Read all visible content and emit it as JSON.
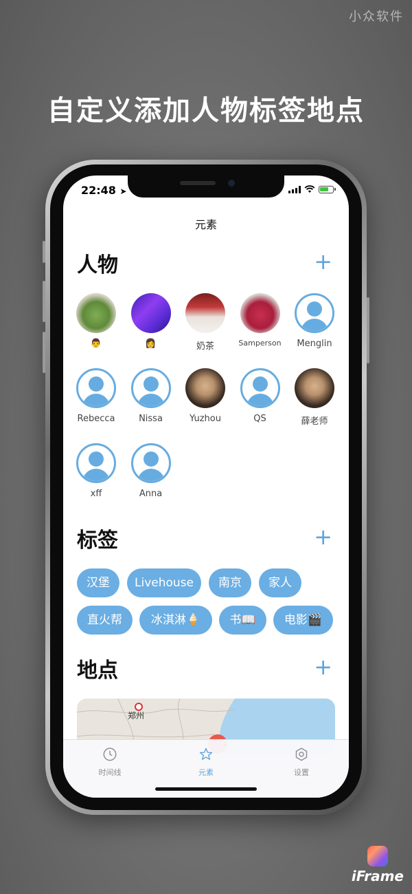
{
  "watermark": "小众软件",
  "headline": "自定义添加人物标签地点",
  "status": {
    "time": "22:48"
  },
  "nav_title": "元素",
  "sections": {
    "people": {
      "title": "人物"
    },
    "tags": {
      "title": "标签"
    },
    "places": {
      "title": "地点"
    }
  },
  "people": [
    {
      "name": "👨",
      "avatar": "photo-food"
    },
    {
      "name": "👩",
      "avatar": "photo-purple"
    },
    {
      "name": "奶茶",
      "avatar": "photo-milktea"
    },
    {
      "name": "Samperson",
      "avatar": "photo-bear"
    },
    {
      "name": "Menglin",
      "avatar": "default"
    },
    {
      "name": "Rebecca",
      "avatar": "default"
    },
    {
      "name": "Nissa",
      "avatar": "default"
    },
    {
      "name": "Yuzhou",
      "avatar": "photo-person"
    },
    {
      "name": "QS",
      "avatar": "default"
    },
    {
      "name": "薛老师",
      "avatar": "photo-person"
    },
    {
      "name": "xff",
      "avatar": "default"
    },
    {
      "name": "Anna",
      "avatar": "default"
    }
  ],
  "tags": [
    "汉堡",
    "Livehouse",
    "南京",
    "家人",
    "直火帮",
    "冰淇淋🍦",
    "书📖",
    "电影🎬"
  ],
  "map": {
    "city_label": "郑州"
  },
  "tabs": [
    {
      "label": "时间线",
      "icon": "clock-icon",
      "active": false
    },
    {
      "label": "元素",
      "icon": "star-icon",
      "active": true
    },
    {
      "label": "设置",
      "icon": "settings-icon",
      "active": false
    }
  ],
  "brand": {
    "logo_text": "iFrame"
  },
  "colors": {
    "accent": "#6aaee3",
    "tab_active": "#5ea4dc"
  }
}
